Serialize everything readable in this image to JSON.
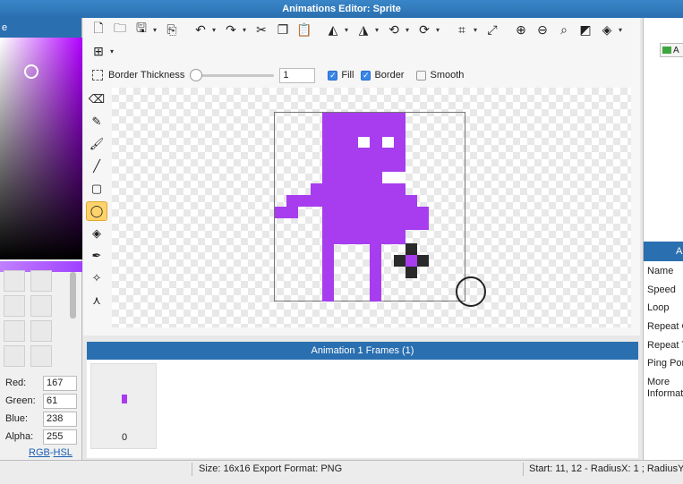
{
  "window": {
    "title": "Animations Editor: Sprite"
  },
  "left_panel": {
    "header": "e"
  },
  "color": {
    "red_label": "Red:",
    "red": "167",
    "green_label": "Green:",
    "green": "61",
    "blue_label": "Blue:",
    "blue": "238",
    "alpha_label": "Alpha:",
    "alpha": "255",
    "rgb_link": "RGB",
    "separator": "-",
    "hsl_link": "HSL",
    "fill_color": "#a73dee"
  },
  "options": {
    "border_thickness_label": "Border Thickness",
    "border_thickness_value": "1",
    "fill_label": "Fill",
    "border_label": "Border",
    "smooth_label": "Smooth"
  },
  "frames": {
    "header": "Animation 1 Frames (1)",
    "frame_number": "0"
  },
  "right_panel": {
    "top_button_label": "A",
    "props_header": "A",
    "props": [
      "Name",
      "Speed",
      "Loop",
      "Repeat C",
      "Repeat T",
      "Ping Por",
      "More",
      "Informat"
    ]
  },
  "status": {
    "size_format": "Size: 16x16   Export Format: PNG",
    "coords": "Start: 11, 12 - RadiusX: 1 ; RadiusY"
  }
}
